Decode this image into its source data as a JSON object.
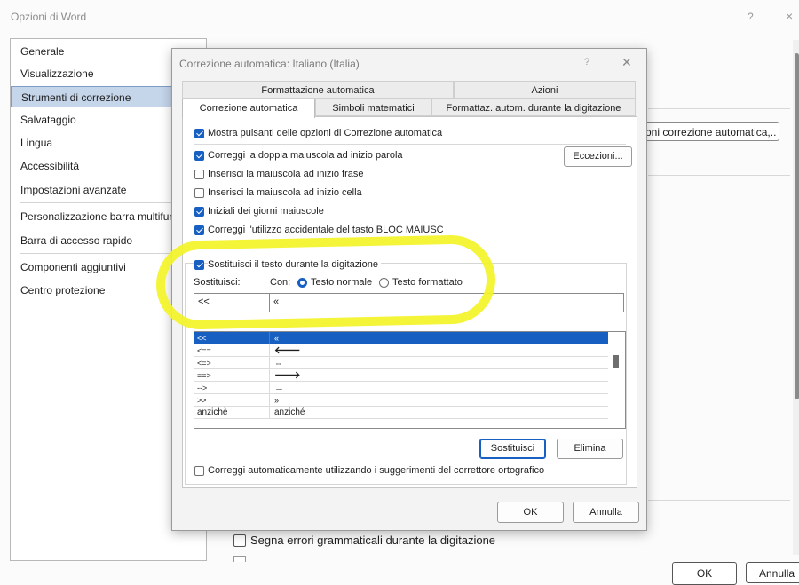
{
  "window": {
    "title": "Opzioni di Word",
    "help_glyph": "?",
    "close_glyph": "×",
    "nav_items": [
      {
        "label": "Generale"
      },
      {
        "label": "Visualizzazione"
      },
      {
        "label": "Strumenti di correzione"
      },
      {
        "label": "Salvataggio"
      },
      {
        "label": "Lingua"
      },
      {
        "label": "Accessibilità"
      },
      {
        "label": "Impostazioni avanzate"
      },
      {
        "label": "Personalizzazione barra multifunzione"
      },
      {
        "label": "Barra di accesso rapido"
      },
      {
        "label": "Componenti aggiuntivi"
      },
      {
        "label": "Centro protezione"
      }
    ],
    "selected_nav": "Strumenti di correzione",
    "bg_button_label": "oni correzione automatica,..",
    "bg_checkbox_label": "Segna errori grammaticali durante la digitazione",
    "ok_label": "OK",
    "cancel_label": "Annulla"
  },
  "dialog": {
    "title": "Correzione automatica: Italiano (Italia)",
    "help_glyph": "?",
    "close_glyph": "✕",
    "tabs_top": [
      "Formattazione automatica",
      "Azioni"
    ],
    "tabs_bottom": [
      "Correzione automatica",
      "Simboli matematici",
      "Formattaz. autom. durante la digitazione"
    ],
    "active_tab": "Correzione automatica",
    "show_buttons_label": "Mostra pulsanti delle opzioni di Correzione automatica",
    "options": [
      {
        "label": "Correggi la doppia maiuscola ad inizio parola",
        "checked": true
      },
      {
        "label": "Inserisci la maiuscola ad inizio frase",
        "checked": false
      },
      {
        "label": "Inserisci la maiuscola ad inizio cella",
        "checked": false
      },
      {
        "label": "Iniziali dei giorni maiuscole",
        "checked": true
      },
      {
        "label": "Correggi l'utilizzo accidentale del tasto BLOC MAIUSC",
        "checked": true
      }
    ],
    "exceptions_label": "Eccezioni...",
    "replace_while_typing_label": "Sostituisci il testo durante la digitazione",
    "replace_label": "Sostituisci:",
    "with_label": "Con:",
    "radio_plain": "Testo normale",
    "radio_formatted": "Testo formattato",
    "replace_value": "<<",
    "with_value": "«",
    "entries": [
      {
        "from": "<<",
        "to": "«"
      },
      {
        "from": "<==",
        "to": "🡐"
      },
      {
        "from": "<=>",
        "to": "⇔"
      },
      {
        "from": "==>",
        "to": "🡒"
      },
      {
        "from": "-->",
        "to": "→"
      },
      {
        "from": ">>",
        "to": "»"
      },
      {
        "from": "anzichè",
        "to": "anziché"
      }
    ],
    "replace_button": "Sostituisci",
    "delete_button": "Elimina",
    "spell_suggest_label": "Correggi automaticamente utilizzando i suggerimenti del correttore ortografico",
    "ok_label": "OK",
    "cancel_label": "Annulla"
  },
  "colors": {
    "accent": "#1760c2",
    "highlighter": "#f3f328",
    "nav_selected": "#c5d5ea"
  }
}
